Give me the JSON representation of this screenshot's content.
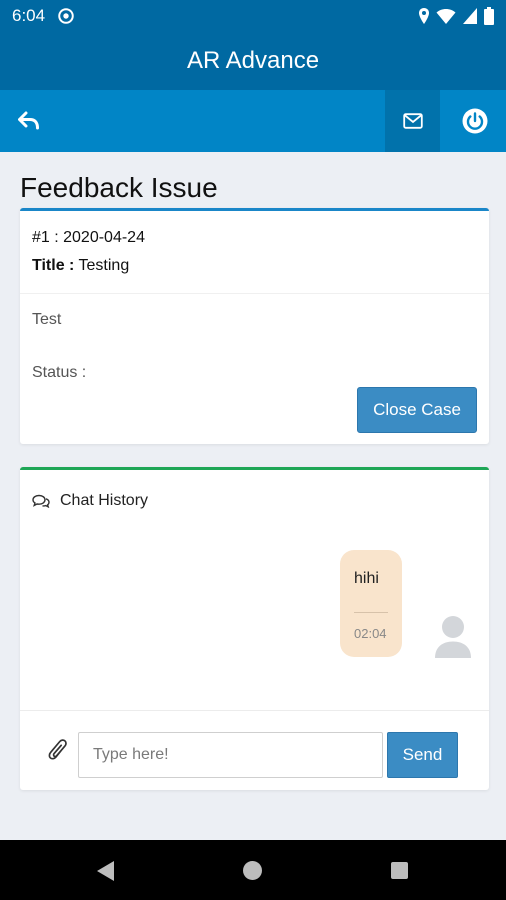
{
  "status_bar": {
    "time": "6:04"
  },
  "app": {
    "title": "AR Advance"
  },
  "toolbar": {
    "back_icon": "reply-icon",
    "mail_icon": "envelope-icon",
    "power_icon": "power-icon"
  },
  "page": {
    "title": "Feedback Issue"
  },
  "issue": {
    "id_line": "#1 : 2020-04-24",
    "title_label": "Title :",
    "title_value": "Testing",
    "description": "Test",
    "status_label": "Status :",
    "close_button": "Close Case"
  },
  "chat": {
    "header": "Chat History",
    "messages": [
      {
        "text": "hihi",
        "time": "02:04"
      }
    ],
    "input_placeholder": "Type here!",
    "send_label": "Send"
  },
  "colors": {
    "primary_dark": "#0069a2",
    "primary": "#0185c6",
    "accent_blue": "#1a86c8",
    "accent_green": "#1ea656",
    "bubble": "#f9e4cc",
    "button": "#3b8cc4"
  }
}
